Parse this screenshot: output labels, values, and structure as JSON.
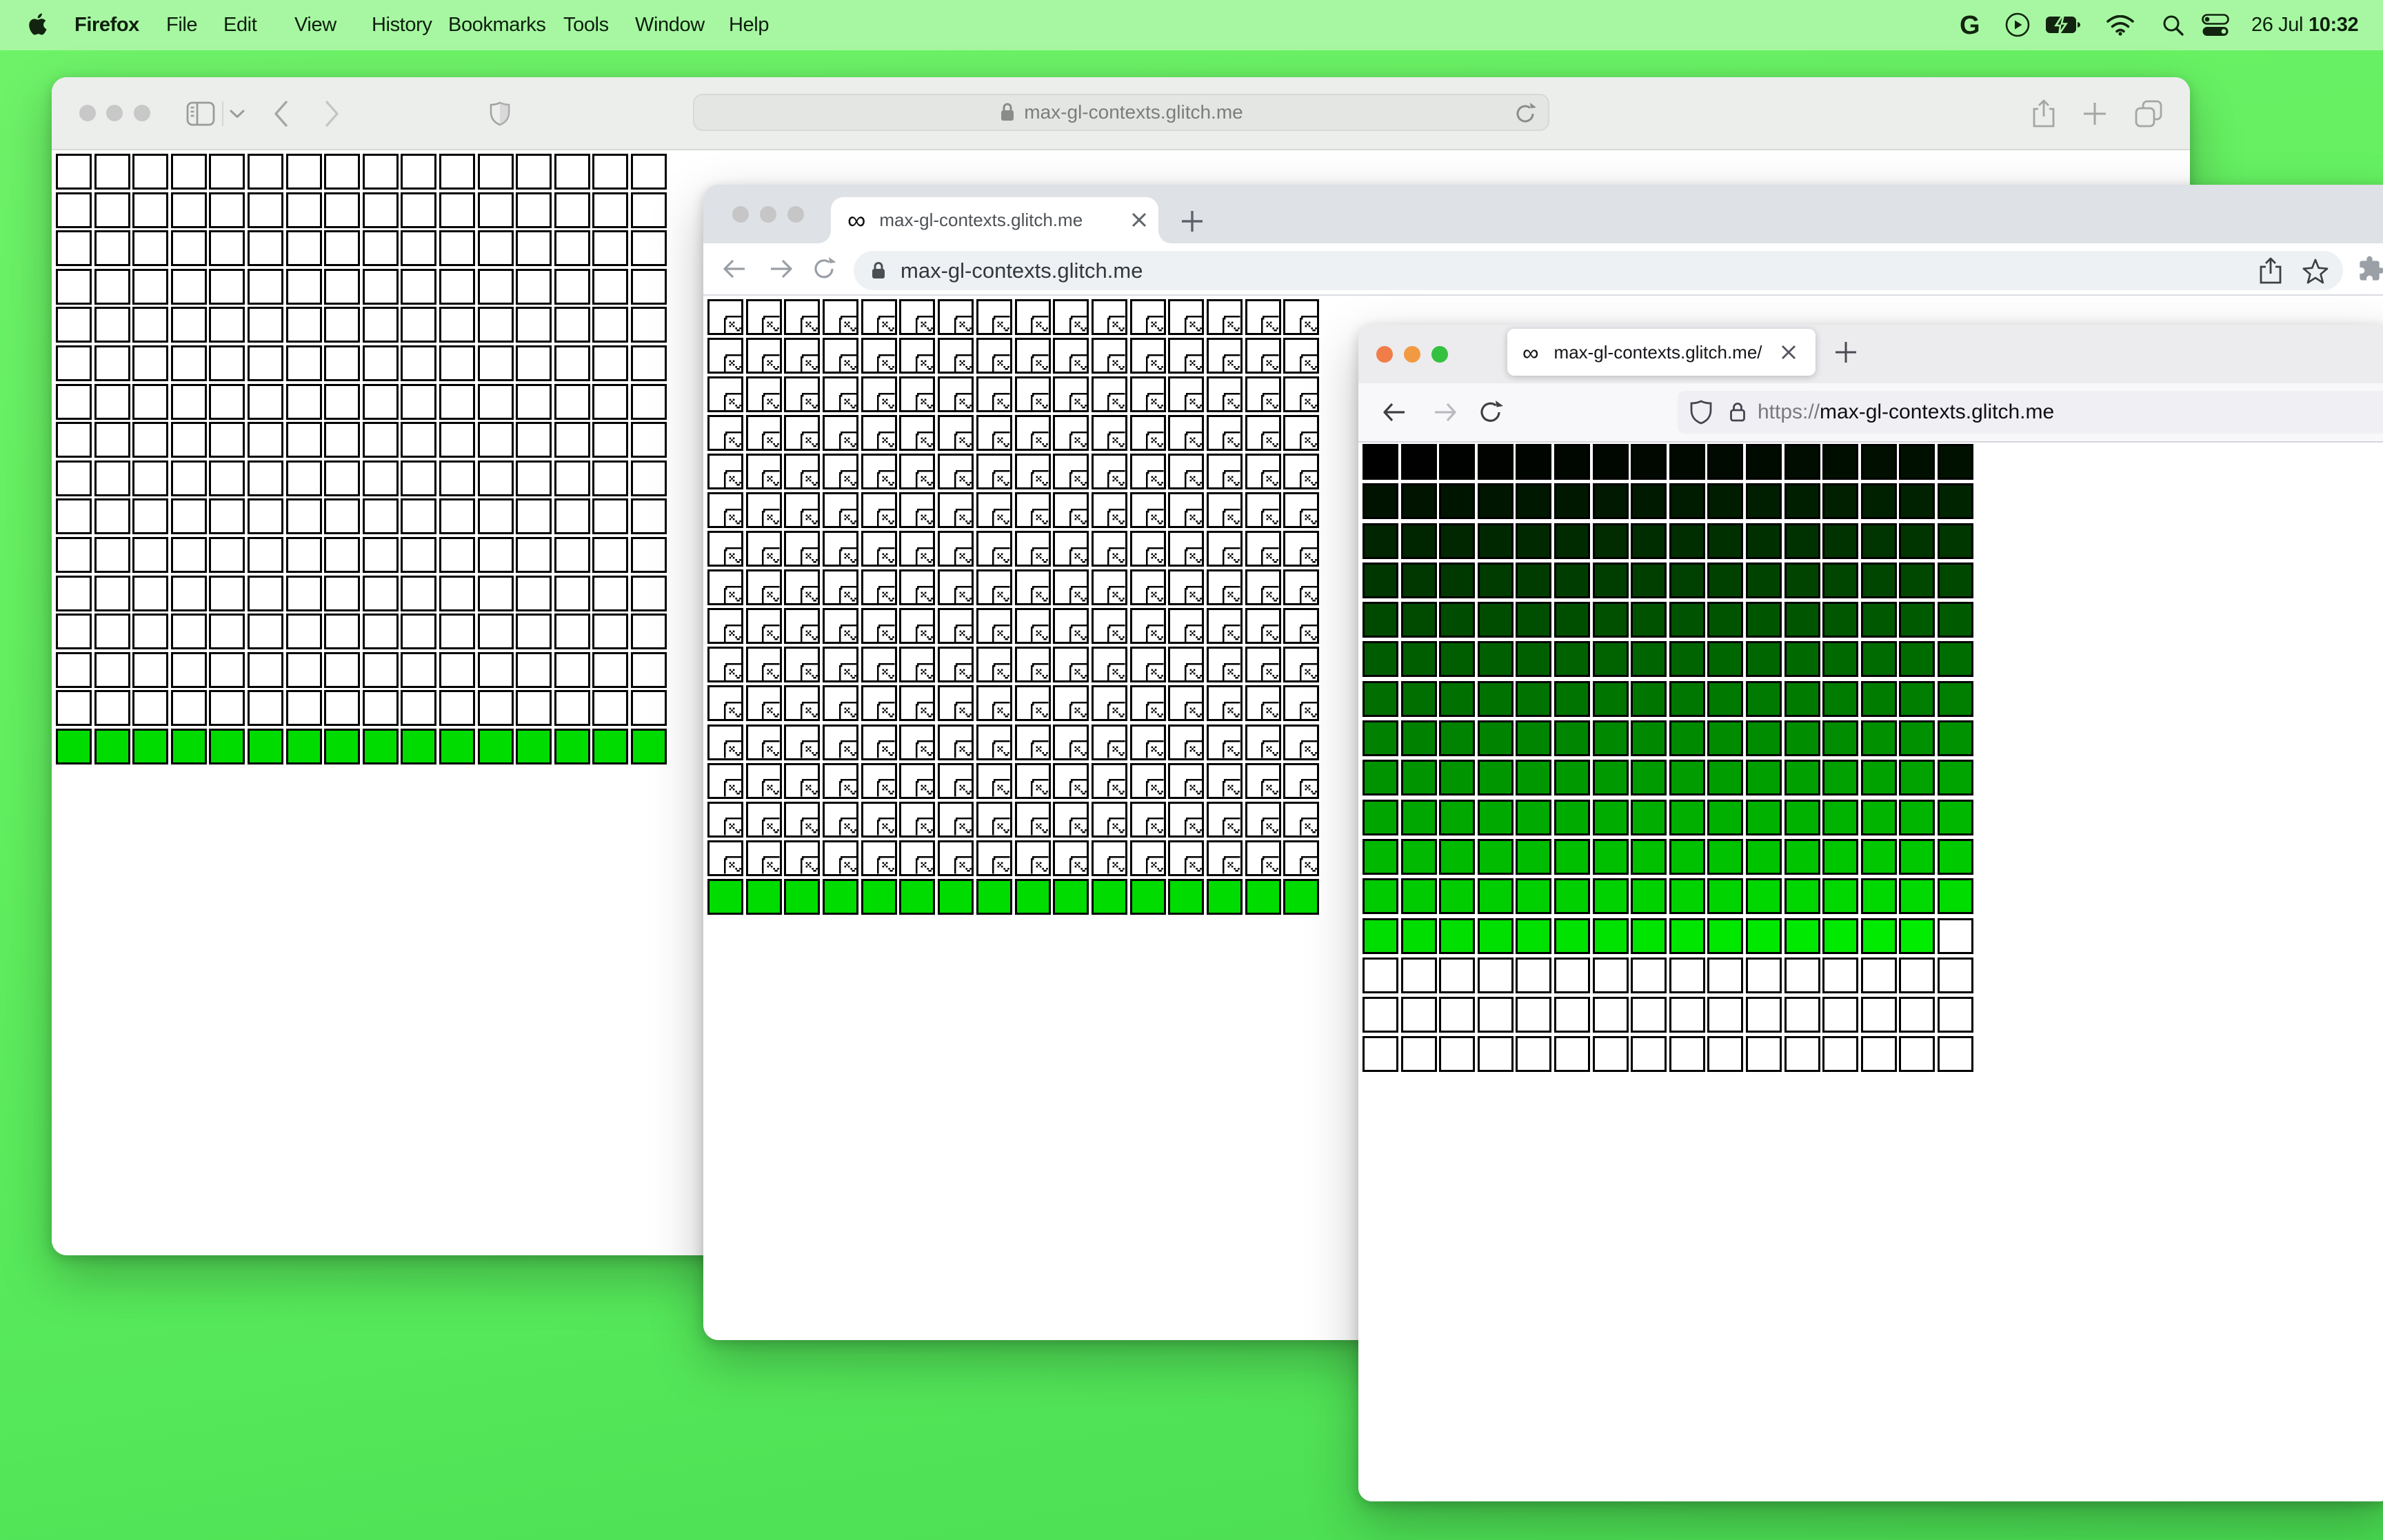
{
  "menubar": {
    "app_name": "Firefox",
    "menus": [
      "File",
      "Edit",
      "View",
      "History",
      "Bookmarks",
      "Tools",
      "Window",
      "Help"
    ],
    "status_icon_names": [
      "google-g-icon",
      "play-circle-icon",
      "battery-charging-icon",
      "wifi-icon",
      "search-icon",
      "control-center-icon"
    ],
    "date": "26 Jul",
    "time": "10:32"
  },
  "site": {
    "url": "max-gl-contexts.glitch.me"
  },
  "windows": {
    "safari": {
      "browser": "Safari",
      "url": "max-gl-contexts.glitch.me",
      "grid": {
        "cols": 16,
        "rows": 16,
        "type": "blank",
        "green_last_row": true,
        "green": "#00dc00"
      }
    },
    "chrome": {
      "browser": "Chrome",
      "tab_title": "max-gl-contexts.glitch.me",
      "url": "max-gl-contexts.glitch.me",
      "grid": {
        "cols": 16,
        "rows": 16,
        "type": "broken-image",
        "green_last_row": true,
        "green": "#00dc00"
      }
    },
    "firefox": {
      "browser": "Firefox",
      "tab_title": "max-gl-contexts.glitch.me/",
      "url_scheme": "https://",
      "url_host": "max-gl-contexts.glitch.me",
      "grid": {
        "cols": 16,
        "rows": 16,
        "type": "gradient",
        "colored_cells": 207,
        "green_channel_scale": 1.1486
      }
    }
  },
  "chart_data": {
    "type": "heatmap",
    "description": "Each browser window shows a 16x16 grid of WebGL canvases from max-gl-contexts.glitch.me",
    "safari_grid": "15 rows blank white, last row green",
    "chrome_grid": "15 rows broken-image placeholders, last row green",
    "firefox_grid": "cells 0-206 shaded rgb(0, round(index*1.1486), 0) from black to bright green, cells 207-255 white"
  }
}
